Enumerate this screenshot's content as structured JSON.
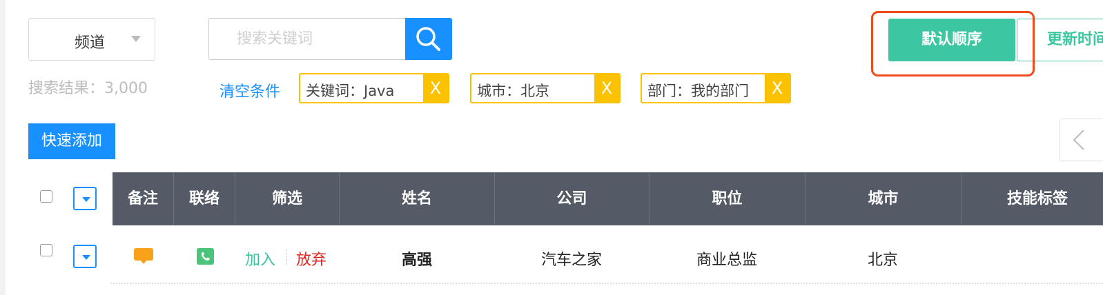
{
  "toolbar": {
    "channel_label": "频道",
    "search_placeholder": "搜索关键词",
    "result_count": "搜索结果：3,000",
    "clear_label": "清空条件",
    "tags": [
      {
        "label": "关键词：Java",
        "remove": "X"
      },
      {
        "label": "城市：北京",
        "remove": "X"
      },
      {
        "label": "部门：我的部门",
        "remove": "X"
      }
    ],
    "sort_default_label": "默认顺序",
    "sort_update_label": "更新时间",
    "quick_add_label": "快速添加"
  },
  "colors": {
    "primary": "#1890ff",
    "accent_green": "#3cc6a1",
    "tag_yellow": "#fcc200",
    "header_gray": "#545b67",
    "highlight_red": "#f04a1c",
    "danger_red": "#e0241e"
  },
  "table": {
    "columns": [
      "备注",
      "联络",
      "筛选",
      "姓名",
      "公司",
      "职位",
      "城市",
      "技能标签"
    ],
    "rows": [
      {
        "note_icon": "comment-icon",
        "contact_icon": "phone-icon",
        "action_join": "加入",
        "action_quit": "放弃",
        "name": "高强",
        "company": "汽车之家",
        "position": "商业总监",
        "city": "北京"
      }
    ]
  }
}
